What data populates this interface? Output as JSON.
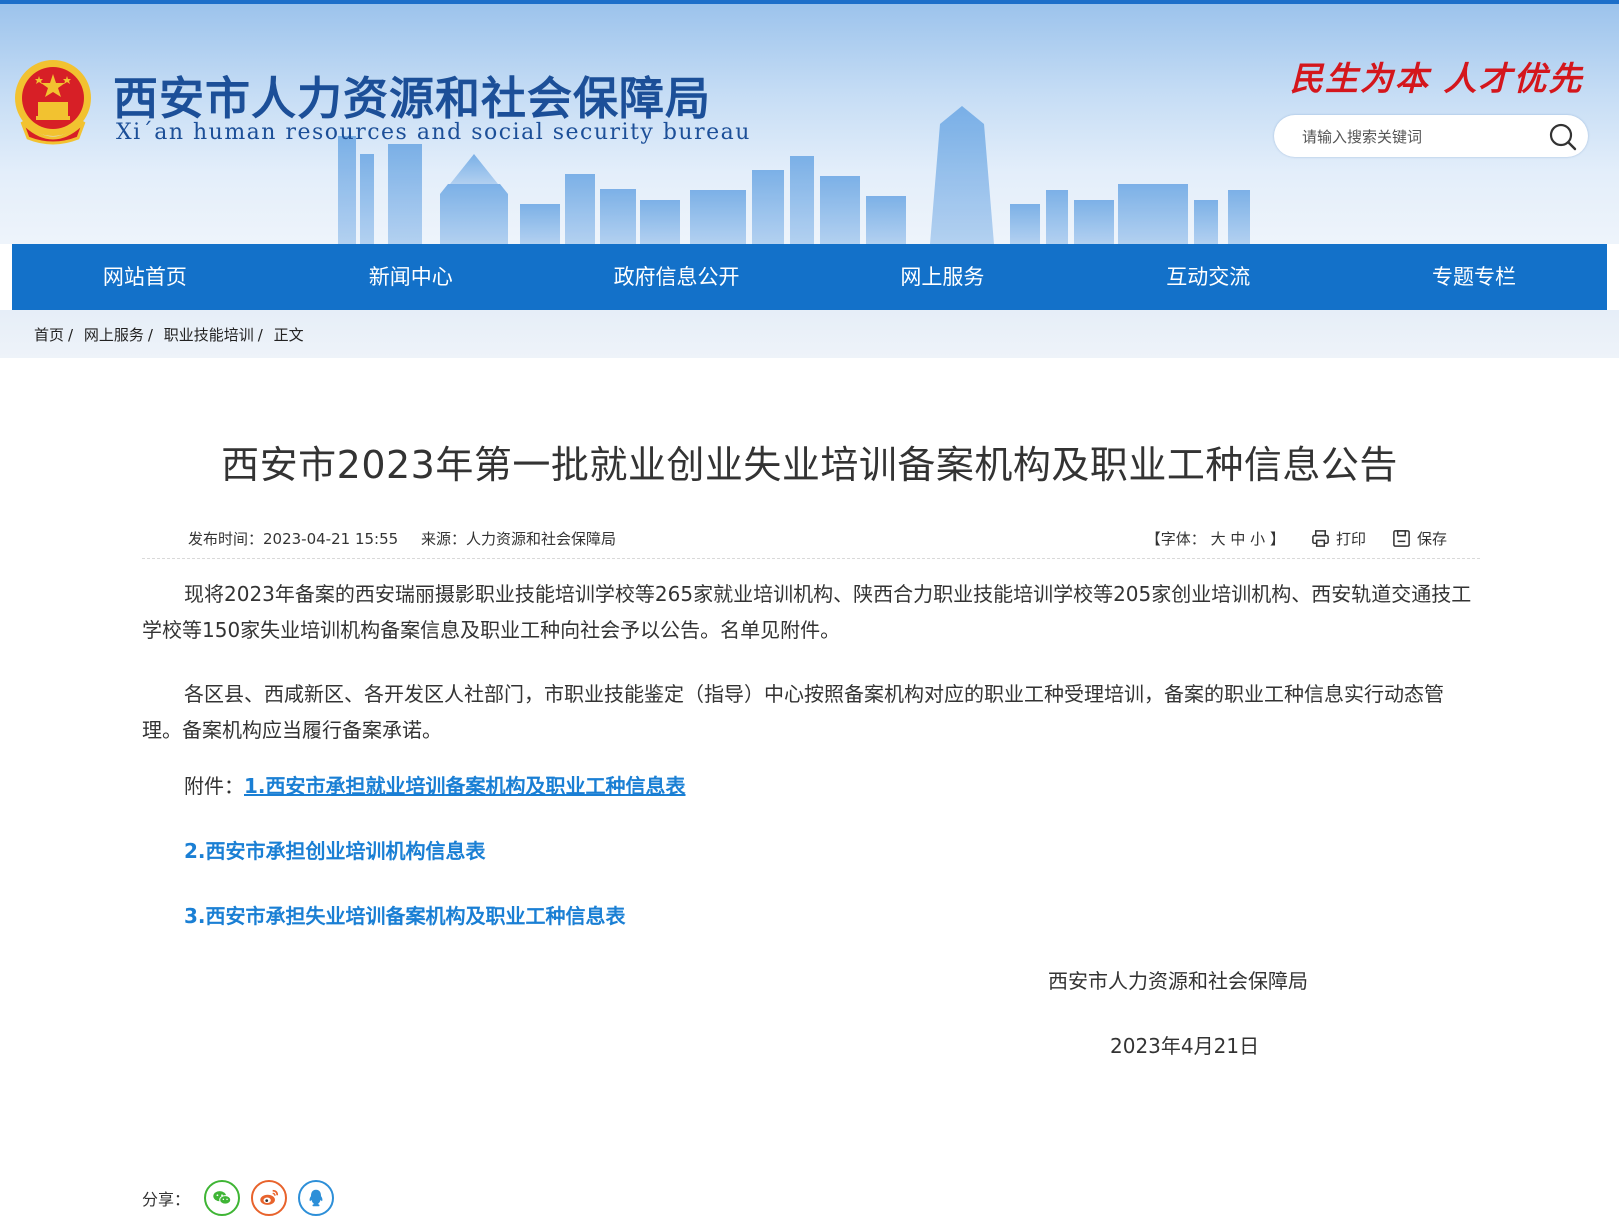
{
  "header": {
    "title": "西安市人力资源和社会保障局",
    "subtitle": "Xi´an human resources and social security bureau",
    "slogan": "民生为本 人才优先",
    "search_placeholder": "请输入搜索关键词",
    "icons": [
      "national-emblem",
      "search-icon"
    ]
  },
  "nav": {
    "items": [
      "网站首页",
      "新闻中心",
      "政府信息公开",
      "网上服务",
      "互动交流",
      "专题专栏"
    ]
  },
  "breadcrumb": {
    "items": [
      "首页",
      "网上服务",
      "职业技能培训",
      "正文"
    ]
  },
  "article": {
    "title": "西安市2023年第一批就业创业失业培训备案机构及职业工种信息公告",
    "publish_time": "发布时间：2023-04-21 15:55",
    "source": "来源：人力资源和社会保障局",
    "font_label_open": "【字体：",
    "font_large": "大",
    "font_medium": "中",
    "font_small": "小",
    "font_label_close": "】",
    "print_label": "打印",
    "save_label": "保存",
    "paragraph_1": "现将2023年备案的西安瑞丽摄影职业技能培训学校等265家就业培训机构、陕西合力职业技能培训学校等205家创业培训机构、西安轨道交通技工学校等150家失业培训机构备案信息及职业工种向社会予以公告。名单见附件。",
    "paragraph_2": "各区县、西咸新区、各开发区人社部门，市职业技能鉴定（指导）中心按照备案机构对应的职业工种受理培训，备案的职业工种信息实行动态管理。备案机构应当履行备案承诺。",
    "attachment_label": "附件：",
    "attachments": [
      "1.西安市承担就业培训备案机构及职业工种信息表",
      "2.西安市承担创业培训机构信息表",
      "3.西安市承担失业培训备案机构及职业工种信息表"
    ],
    "signature_org": "西安市人力资源和社会保障局",
    "signature_date": "2023年4月21日",
    "share_label": "分享："
  },
  "colors": {
    "nav_bg": "#1371c9",
    "title_blue": "#1c4f98",
    "slogan_red": "#d4161c",
    "link_blue": "#1a7fd4",
    "wechat_green": "#3fb535",
    "weibo_orange": "#e8632c",
    "qq_blue": "#2d8fd8"
  },
  "share_icons": [
    "wechat-icon",
    "weibo-icon",
    "qq-icon"
  ]
}
